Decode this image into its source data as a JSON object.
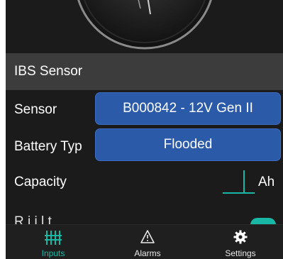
{
  "colors": {
    "background": "#1b1b1b",
    "header": "#3c3c3c",
    "pill": "#2a5aa8",
    "accent": "#18b8a5",
    "text": "#ffffff"
  },
  "gauge": {
    "icon": "gauge-dial"
  },
  "ibs_section": {
    "title": "IBS Sensor"
  },
  "sensor": {
    "label": "Sensor",
    "value": "B000842 - 12V Gen II"
  },
  "battery_type": {
    "label": "Battery Typ",
    "value": "Flooded"
  },
  "capacity": {
    "label": "Capacity",
    "value": "",
    "unit": "Ah"
  },
  "partial_row": {
    "label": "R     i  i    l     t",
    "toggle_on": true
  },
  "nav": {
    "items": [
      {
        "label": "Inputs",
        "icon": "inputs-icon",
        "active": true
      },
      {
        "label": "Alarms",
        "icon": "warning-icon",
        "active": false
      },
      {
        "label": "Settings",
        "icon": "gear-icon",
        "active": false
      }
    ]
  }
}
